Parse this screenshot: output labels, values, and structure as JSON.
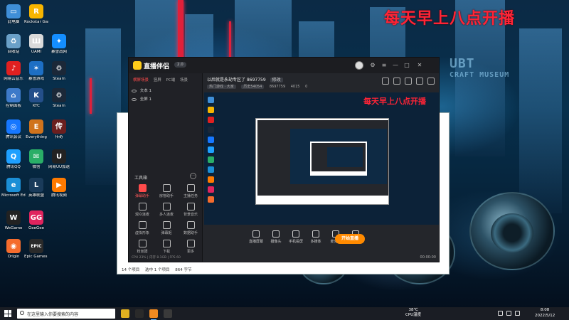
{
  "overlay_text": "每天早上八点开播",
  "desktop_icons": [
    {
      "label": "此电脑",
      "icon": "this-pc-icon",
      "color": "#3f8fd8",
      "glyph": "▭"
    },
    {
      "label": "Rockstar Games",
      "icon": "rockstar-icon",
      "color": "#f7b500",
      "glyph": "R"
    },
    {
      "label": "UAMI",
      "icon": "uami-icon",
      "color": "#d9d9d9",
      "glyph": "Ш"
    },
    {
      "label": "暴雪战网",
      "icon": "battlenet-icon",
      "color": "#148eff",
      "glyph": "✦"
    },
    {
      "label": "回收站",
      "icon": "recycle-bin-icon",
      "color": "#6aa0c8",
      "glyph": "♻"
    },
    {
      "label": "网易云音乐",
      "icon": "netease-music-icon",
      "color": "#e02020",
      "glyph": "♪"
    },
    {
      "label": "暴雪游戏",
      "icon": "blizzard-icon",
      "color": "#1d6fc4",
      "glyph": "✶"
    },
    {
      "label": "Steam",
      "icon": "steam-icon",
      "color": "#1b2838",
      "glyph": "⚙"
    },
    {
      "label": "KTC",
      "icon": "ktc-icon",
      "color": "#244f8a",
      "glyph": "K"
    },
    {
      "label": "控制面板",
      "icon": "control-panel-icon",
      "color": "#3d7ac9",
      "glyph": "⌂"
    },
    {
      "label": "腾讯会议",
      "icon": "tencent-meeting-icon",
      "color": "#1677ff",
      "glyph": "◎"
    },
    {
      "label": "Everything",
      "icon": "everything-icon",
      "color": "#d0731c",
      "glyph": "E"
    },
    {
      "label": "传奇",
      "icon": "legend-game-icon",
      "color": "#6b1f1f",
      "glyph": "传"
    },
    {
      "label": "腾讯QQ",
      "icon": "qq-icon",
      "color": "#1ea0ff",
      "glyph": "Q"
    },
    {
      "label": "微信",
      "icon": "wechat-icon",
      "color": "#2aae67",
      "glyph": "✉"
    },
    {
      "label": "网易UU加速",
      "icon": "uu-booster-icon",
      "color": "#222",
      "glyph": "U"
    },
    {
      "label": "Microsoft Edge",
      "icon": "edge-icon",
      "color": "#1b8fd6",
      "glyph": "e"
    },
    {
      "label": "英雄联盟",
      "icon": "league-icon",
      "color": "#1a3b5a",
      "glyph": "L"
    },
    {
      "label": "腾讯视频",
      "icon": "tencent-video-icon",
      "color": "#ff7a00",
      "glyph": "▶"
    },
    {
      "label": "Steam",
      "icon": "steam-icon-2",
      "color": "#1b2838",
      "glyph": "⚙"
    },
    {
      "label": "WeGame",
      "icon": "wegame-icon",
      "color": "#222",
      "glyph": "W"
    },
    {
      "label": "GeeGee",
      "icon": "gg-icon",
      "color": "#e0245e",
      "glyph": "GG"
    },
    {
      "label": "Origin",
      "icon": "origin-icon",
      "color": "#f56c2d",
      "glyph": "◉"
    },
    {
      "label": "Epic Games Launcher",
      "icon": "epic-icon",
      "color": "#2a2a2a",
      "glyph": "EPIC"
    }
  ],
  "explorer": {
    "status_items": [
      "14 个项目",
      "选中 1 个项目",
      "864 字节"
    ]
  },
  "app": {
    "title": "直播伴侣",
    "version": "2.0",
    "scene_tabs": [
      {
        "label": "横屏场景",
        "active": true
      },
      {
        "label": "竖屏",
        "active": false
      },
      {
        "label": "PC端",
        "active": false
      },
      {
        "label": "场景",
        "active": false
      }
    ],
    "scene_items": [
      "文本 1",
      "全屏 1"
    ],
    "room_title": "以后就是永劫专区了",
    "room_id": "8697759",
    "room_tag": "修改",
    "stats": {
      "category": "热门游戏 · 大家",
      "viewers": "历史54054",
      "likes": "8697759",
      "hot": "4015",
      "gift": "0"
    },
    "tools_title": "工具箱",
    "tools": [
      {
        "label": "弹幕助手",
        "hot": true
      },
      {
        "label": "房管助手",
        "hot": false
      },
      {
        "label": "主播任务",
        "hot": false
      },
      {
        "label": "观众连麦",
        "hot": false
      },
      {
        "label": "多人连麦",
        "hot": false
      },
      {
        "label": "背景音乐",
        "hot": false
      },
      {
        "label": "虚拟形象",
        "hot": false
      },
      {
        "label": "弹幕姬",
        "hot": false
      },
      {
        "label": "数据助手",
        "hot": false
      },
      {
        "label": "粉丝团",
        "hot": false
      },
      {
        "label": "下载",
        "hot": false
      },
      {
        "label": "更多",
        "hot": false
      }
    ],
    "preview_overlay": "每天早上八点开播",
    "bottom_controls": [
      "直播屏幕",
      "摄像头",
      "手机投屏",
      "多媒体",
      "麦克风",
      "扬声器"
    ],
    "start_live_label": "开始直播",
    "status_text": "CPU 23% | 内存 8.1GB | FPS 60",
    "timer": "00:00:00"
  },
  "taskbar": {
    "search_placeholder": "在这里输入你要搜索的内容",
    "weather_temp": "38℃",
    "weather_label": "CPU温度",
    "time": "8:08",
    "date": "2022/5/12"
  }
}
